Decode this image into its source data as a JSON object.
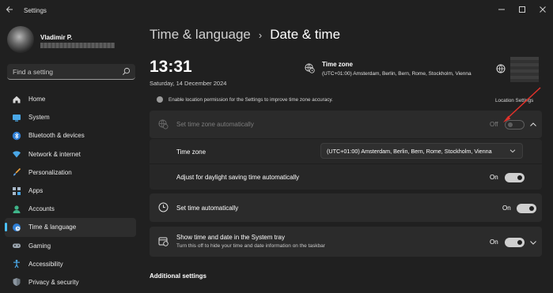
{
  "window": {
    "app_title": "Settings"
  },
  "profile": {
    "name": "Vladimir P."
  },
  "search": {
    "placeholder": "Find a setting"
  },
  "sidebar": {
    "items": [
      {
        "label": "Home",
        "icon": "home-icon",
        "active": false
      },
      {
        "label": "System",
        "icon": "monitor-icon",
        "active": false
      },
      {
        "label": "Bluetooth & devices",
        "icon": "bluetooth-icon",
        "active": false
      },
      {
        "label": "Network & internet",
        "icon": "wifi-icon",
        "active": false
      },
      {
        "label": "Personalization",
        "icon": "brush-icon",
        "active": false
      },
      {
        "label": "Apps",
        "icon": "apps-icon",
        "active": false
      },
      {
        "label": "Accounts",
        "icon": "person-icon",
        "active": false
      },
      {
        "label": "Time & language",
        "icon": "globe-clock-icon",
        "active": true
      },
      {
        "label": "Gaming",
        "icon": "gamepad-icon",
        "active": false
      },
      {
        "label": "Accessibility",
        "icon": "accessibility-icon",
        "active": false
      },
      {
        "label": "Privacy & security",
        "icon": "shield-icon",
        "active": false
      }
    ]
  },
  "header": {
    "parent": "Time & language",
    "separator": "›",
    "current": "Date & time"
  },
  "clock": {
    "time": "13:31",
    "date": "Saturday, 14 December 2024"
  },
  "timezone_summary": {
    "title": "Time zone",
    "value": "(UTC+01:00) Amsterdam, Berlin, Bern, Rome, Stockholm, Vienna"
  },
  "location_notice": {
    "text": "Enable location permission for the Settings to improve time zone accuracy.",
    "link": "Location Settings"
  },
  "settings": {
    "auto_timezone": {
      "label": "Set time zone automatically",
      "state": "Off",
      "enabled": false
    },
    "timezone": {
      "label": "Time zone",
      "value": "(UTC+01:00) Amsterdam, Berlin, Bern, Rome, Stockholm, Vienna"
    },
    "dst": {
      "label": "Adjust for daylight saving time automatically",
      "state": "On"
    },
    "auto_time": {
      "label": "Set time automatically",
      "state": "On"
    },
    "tray": {
      "label": "Show time and date in the System tray",
      "sub": "Turn this off to hide your time and date information on the taskbar",
      "state": "On"
    }
  },
  "additional": {
    "heading": "Additional settings"
  },
  "colors": {
    "background": "#202020",
    "card": "#2b2b2b",
    "accent": "#4cc2ff",
    "annotation_arrow": "#e0312a"
  }
}
